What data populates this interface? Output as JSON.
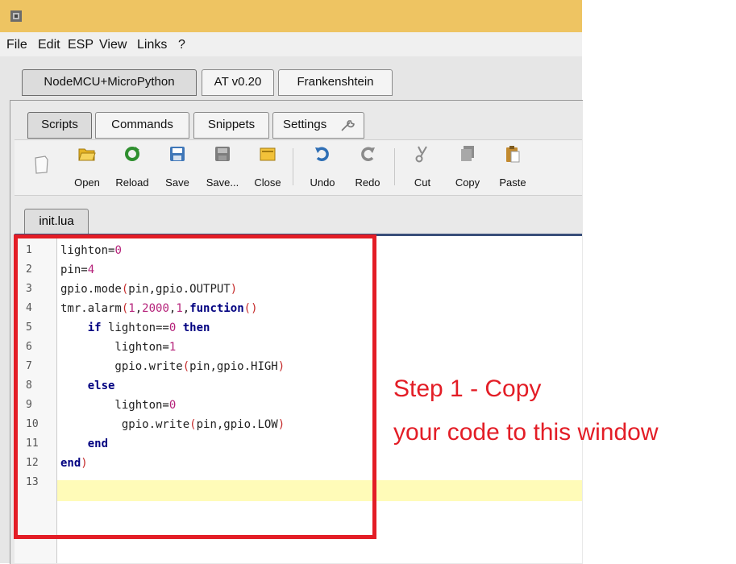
{
  "menu": [
    "File",
    "Edit",
    "ESP",
    "View",
    "Links",
    "?"
  ],
  "device_tabs": [
    "NodeMCU+MicroPython",
    "AT v0.20",
    "Frankenshtein"
  ],
  "section_tabs": [
    "Scripts",
    "Commands",
    "Snippets",
    "Settings"
  ],
  "toolbar": {
    "open": "Open",
    "reload": "Reload",
    "save": "Save",
    "save_as": "Save...",
    "close": "Close",
    "undo": "Undo",
    "redo": "Redo",
    "cut": "Cut",
    "copy": "Copy",
    "paste": "Paste"
  },
  "file_tab": "init.lua",
  "line_numbers": [
    "1",
    "2",
    "3",
    "4",
    "5",
    "6",
    "7",
    "8",
    "9",
    "10",
    "11",
    "12",
    "13"
  ],
  "code_lines": [
    "lighton=0",
    "pin=4",
    "gpio.mode(pin,gpio.OUTPUT)",
    "tmr.alarm(1,2000,1,function()",
    "    if lighton==0 then",
    "        lighton=1",
    "        gpio.write(pin,gpio.HIGH)",
    "    else",
    "        lighton=0",
    "         gpio.write(pin,gpio.LOW)",
    "    end",
    "end)",
    ""
  ],
  "annotation": {
    "line1": "Step 1 - Copy",
    "line2": "your code to this window"
  },
  "colors": {
    "titlebar": "#eec462",
    "highlight_box": "#e31d26",
    "current_line": "#fffbb8",
    "keyword": "#000080",
    "number": "#b5227a",
    "function": "#c52a2a"
  }
}
